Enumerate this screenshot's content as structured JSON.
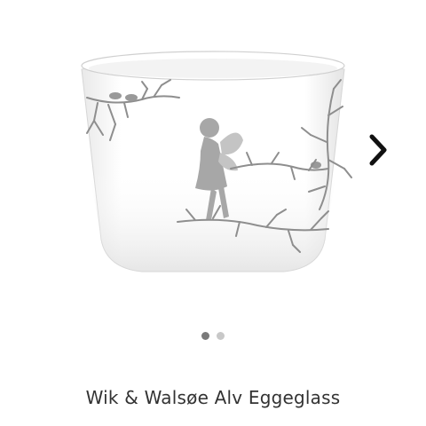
{
  "product": {
    "title": "Wik & Walsøe Alv Eggeglass",
    "image": "white porcelain egg cup with silver fairy and branch print"
  },
  "carousel": {
    "next_icon": "chevron-right-icon",
    "slides_total": 2,
    "active_slide": 1
  },
  "colors": {
    "arrow": "#111111",
    "dot_active": "#7a7a7a",
    "dot_inactive": "#c8c8c8",
    "title_text": "#333333",
    "print": "#8e8e8e"
  }
}
